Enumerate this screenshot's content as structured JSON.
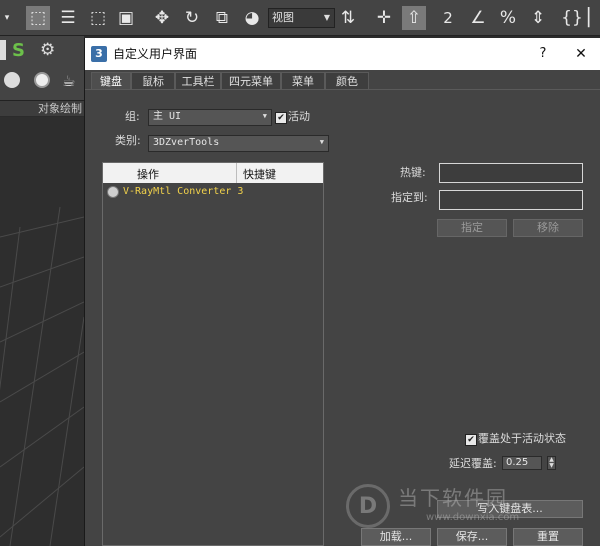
{
  "toolbar": {
    "view_combo": "视图",
    "icons": [
      "selection-region-icon",
      "select-object-icon",
      "select-by-name-icon",
      "rectangle-region-icon",
      "window-crossing-icon",
      "select-move-icon",
      "select-rotate-icon",
      "select-scale-icon",
      "placement-icon",
      "reference-coordinate-icon",
      "pivot-icon",
      "select-manipulate-icon",
      "keyboard-shortcut-override-icon",
      "snaps-toggle-icon",
      "angle-snap-icon",
      "percent-snap-icon",
      "spinner-snap-icon",
      "edit-named-selection-icon",
      "mirror-icon"
    ]
  },
  "side_panel": {
    "label": "对象绘制"
  },
  "dialog": {
    "icon": "3",
    "title": "自定义用户界面",
    "help": "?",
    "close": "✕",
    "tabs": [
      "键盘",
      "鼠标",
      "工具栏",
      "四元菜单",
      "菜单",
      "颜色"
    ],
    "active_tab": "键盘",
    "group_label": "组:",
    "group_value": "主 UI",
    "active_label": "活动",
    "category_label": "类别:",
    "category_value": "3DZverTools",
    "list": {
      "col_action": "操作",
      "col_shortcut": "快捷键",
      "rows": [
        {
          "action": "V-RayMtl Converter 3",
          "shortcut": ""
        }
      ]
    },
    "hotkey_label": "热键:",
    "assign_to_label": "指定到:",
    "assign_button": "指定",
    "remove_button": "移除",
    "override_label": "覆盖处于活动状态",
    "delay_label": "延迟覆盖:",
    "delay_value": "0.25",
    "write_keyboard_button": "写入键盘表...",
    "load_button": "加载...",
    "save_button": "保存...",
    "reset_button": "重置"
  },
  "watermark": {
    "text": "当下软件园",
    "url": "www.downxia.com"
  }
}
